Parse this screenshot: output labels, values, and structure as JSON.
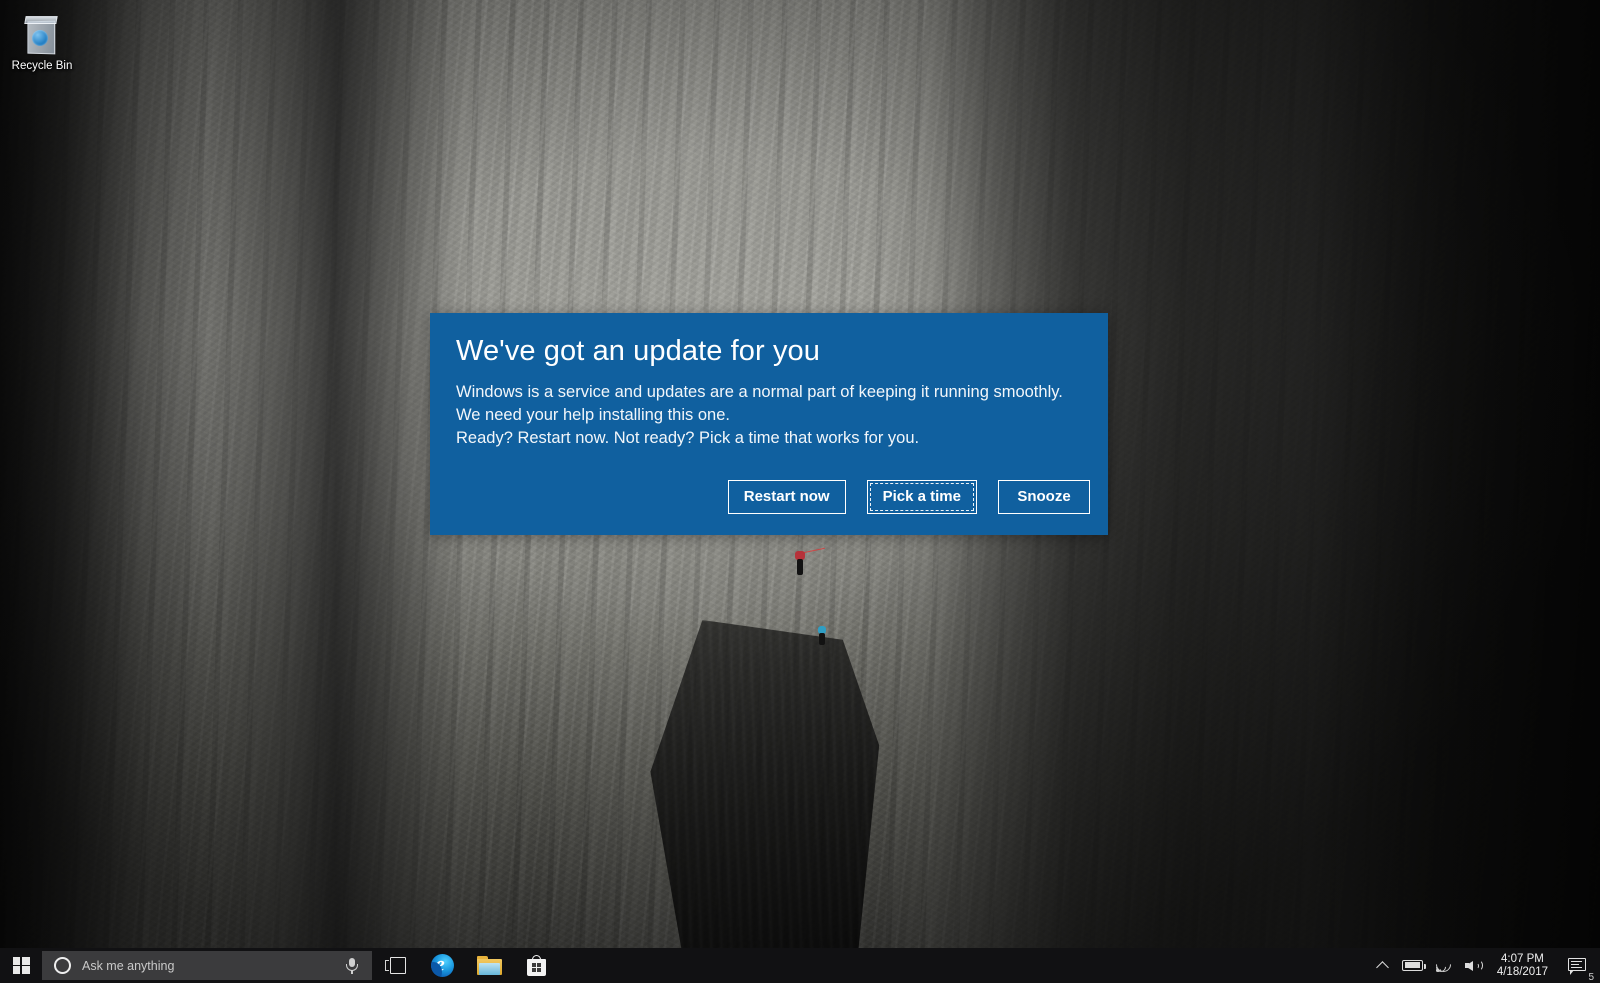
{
  "desktop": {
    "recycle_bin": {
      "label": "Recycle Bin",
      "icon": "recycle-bin-icon"
    },
    "wallpaper_description": "Grey granite cliff face with climbers"
  },
  "dialog": {
    "title": "We've got an update for you",
    "body_line_1": "Windows is a service and updates are a normal part of keeping it running smoothly. We need your help installing this one.",
    "body_line_2": "Ready? Restart now. Not ready? Pick a time that works for you.",
    "background_color": "#10609f",
    "text_color": "#ffffff",
    "buttons": [
      {
        "label": "Restart now",
        "focused": false
      },
      {
        "label": "Pick a time",
        "focused": true
      },
      {
        "label": "Snooze",
        "focused": false
      }
    ]
  },
  "taskbar": {
    "background_color": "#111113",
    "start": {
      "label": "Start",
      "icon": "windows-logo-icon"
    },
    "search": {
      "placeholder": "Ask me anything",
      "value": "",
      "cortana_icon": "cortana-circle-icon",
      "mic_icon": "microphone-icon",
      "background_color": "#3b3b3d"
    },
    "buttons": [
      {
        "name": "task-view",
        "label": "Task View",
        "icon": "task-view-icon"
      },
      {
        "name": "edge",
        "label": "Microsoft Edge",
        "icon": "edge-icon"
      },
      {
        "name": "file-explorer",
        "label": "File Explorer",
        "icon": "folder-icon"
      },
      {
        "name": "store",
        "label": "Microsoft Store",
        "icon": "store-bag-icon"
      }
    ],
    "tray": {
      "show_hidden_icons": {
        "label": "Show hidden icons",
        "icon": "chevron-up-icon"
      },
      "battery": {
        "label": "Battery",
        "icon": "battery-icon"
      },
      "network": {
        "label": "Network",
        "icon": "wifi-icon"
      },
      "volume": {
        "label": "Volume",
        "icon": "speaker-icon"
      },
      "clock": {
        "time": "4:07 PM",
        "date": "4/18/2017"
      },
      "action_center": {
        "label": "Action Center",
        "icon": "notification-icon",
        "badge_count": "5"
      },
      "show_desktop": {
        "label": "Show desktop"
      }
    }
  }
}
